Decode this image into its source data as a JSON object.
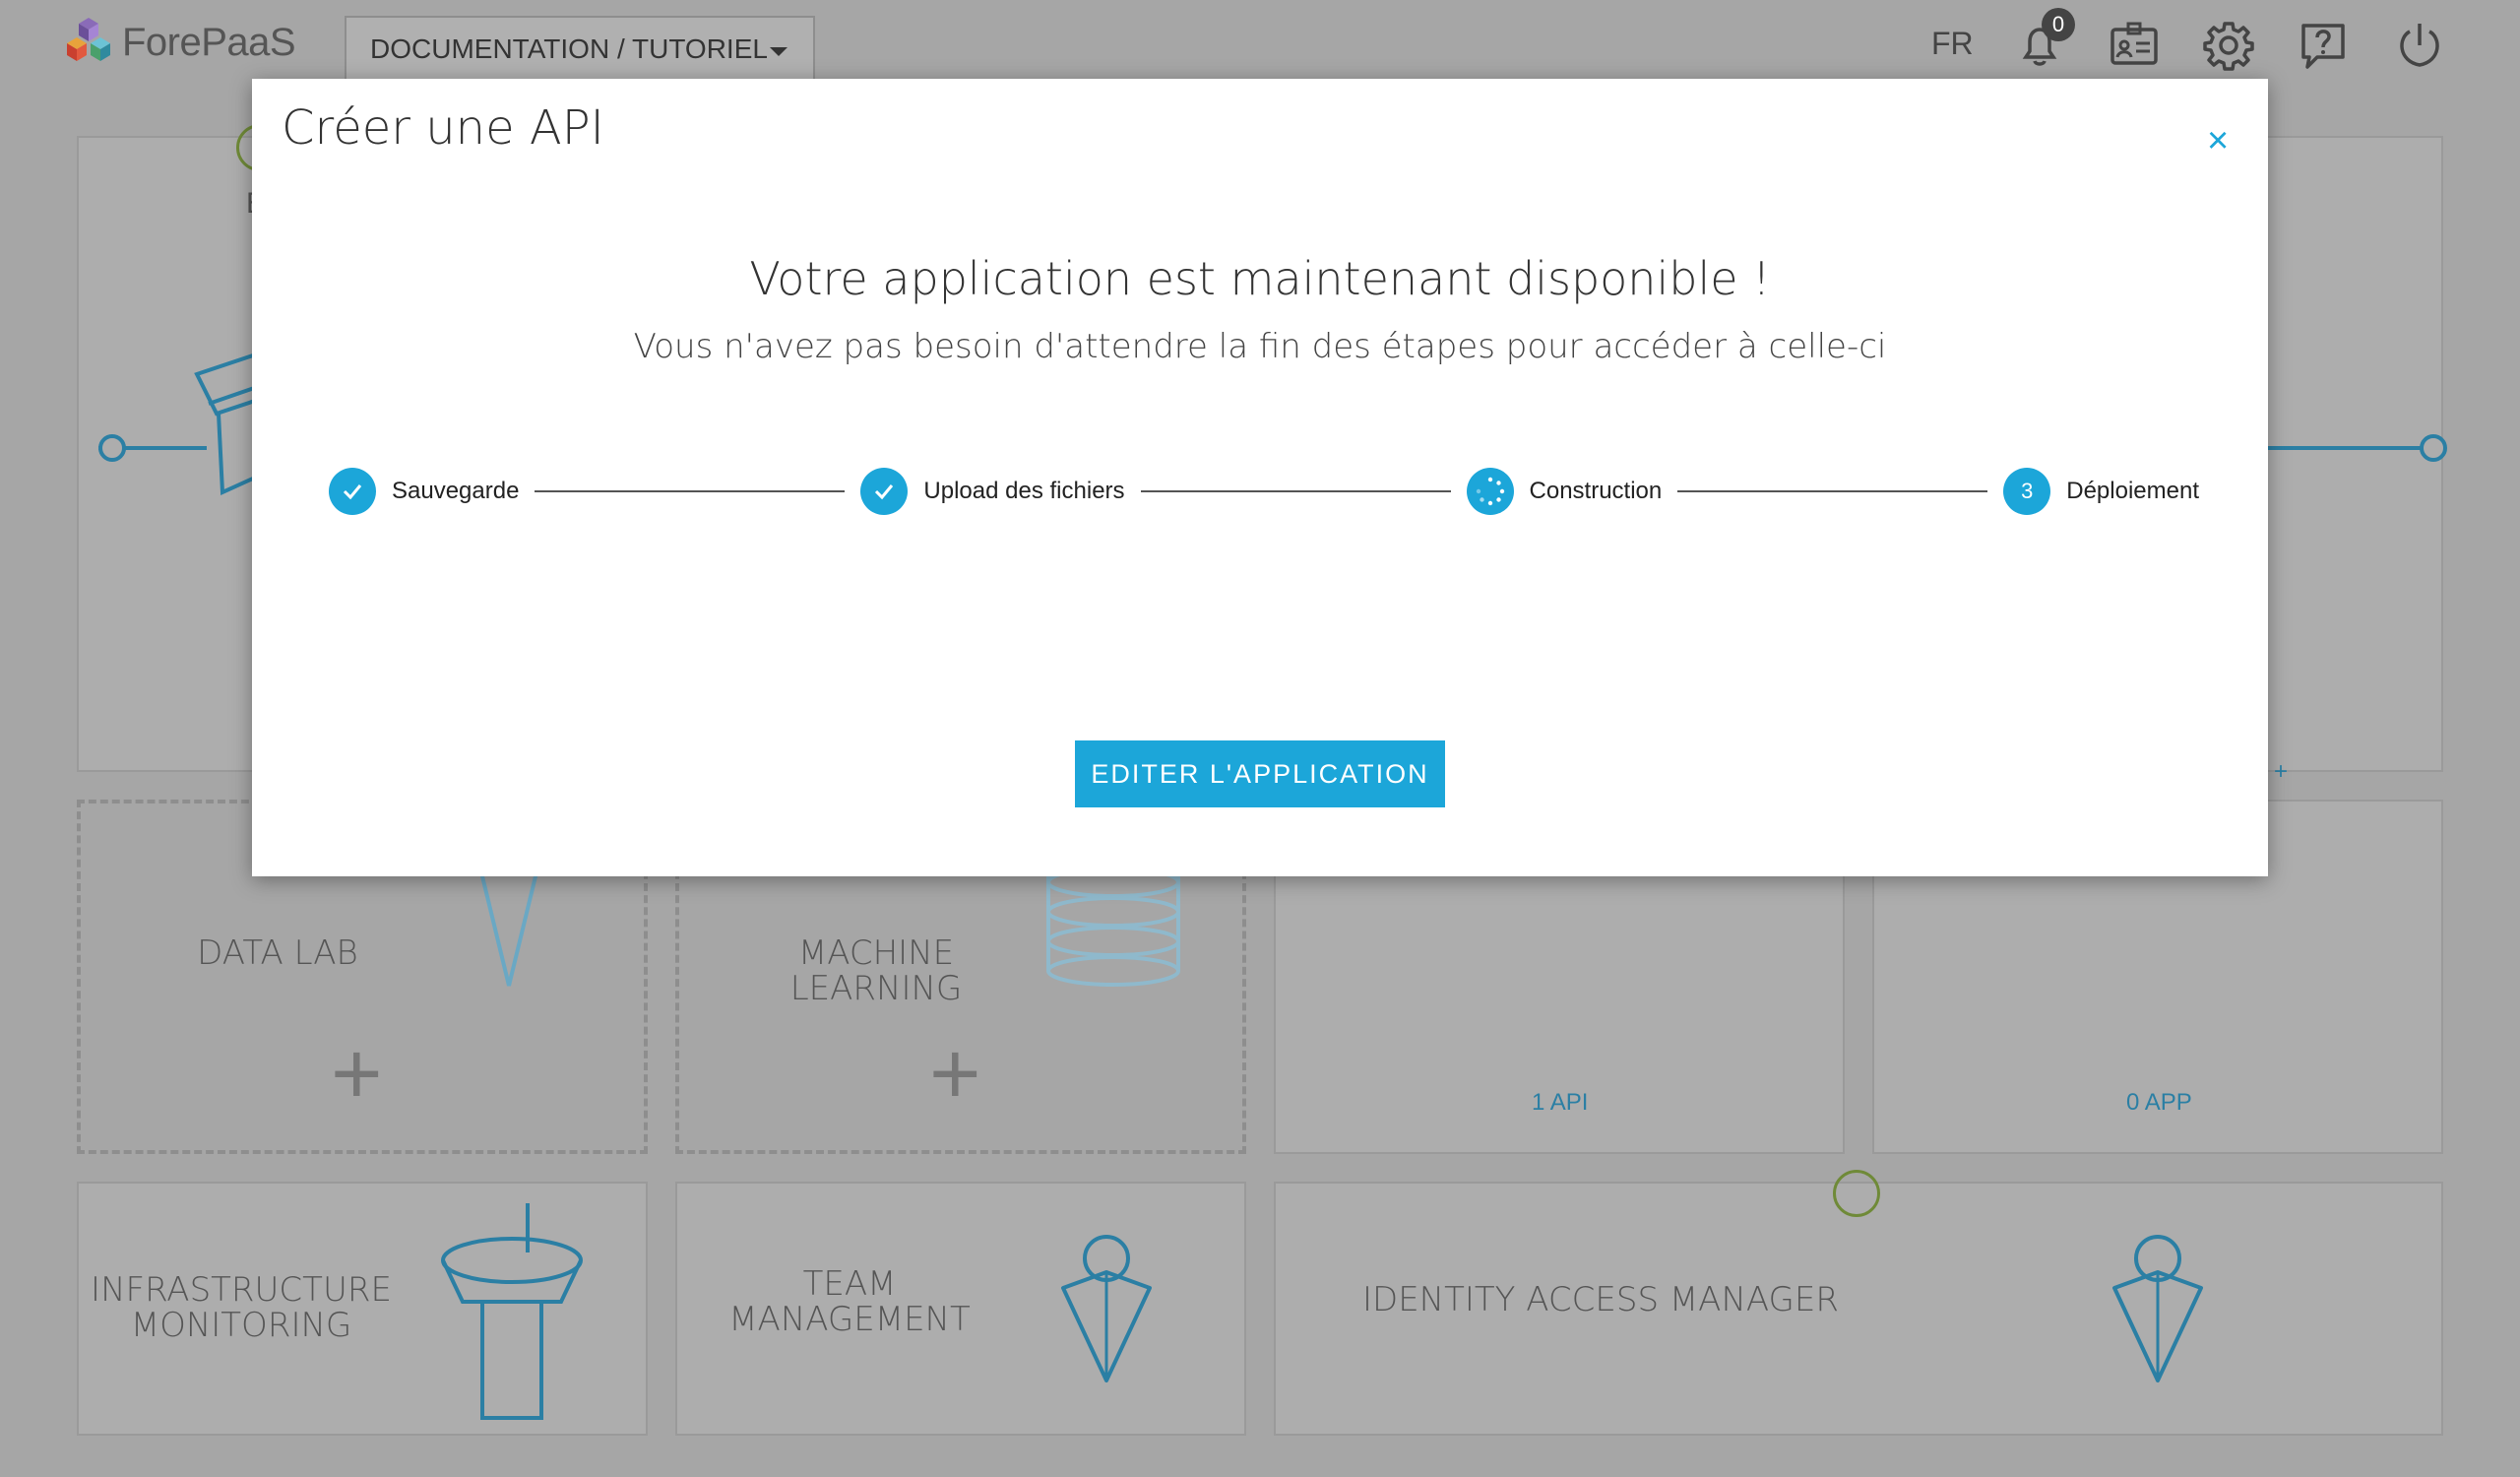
{
  "header": {
    "logo_text": "ForePaaS",
    "project_selector": "DOCUMENTATION / TUTORIEL",
    "language": "FR",
    "notification_count": "0",
    "icons": [
      "bell-icon",
      "id-card-icon",
      "gear-icon",
      "help-icon",
      "power-icon"
    ]
  },
  "tiles": {
    "data_lab": {
      "title": "DATA LAB",
      "plus": "+"
    },
    "machine_learning": {
      "title": "MACHINE LEARNING",
      "plus": "+"
    },
    "api": {
      "count": "1 API"
    },
    "app": {
      "count": "0 APP"
    },
    "infra": {
      "title": "INFRASTRUCTURE MONITORING"
    },
    "team": {
      "title": "TEAM MANAGEMENT"
    },
    "iam": {
      "title": "IDENTITY ACCESS MANAGER"
    },
    "partial_letter": "E",
    "small_plus": "+"
  },
  "modal": {
    "title": "Créer une API",
    "close": "×",
    "heading": "Votre application est maintenant disponible !",
    "subheading": "Vous n'avez pas besoin d'attendre la fin des étapes pour accéder à celle-ci",
    "steps": [
      {
        "label": "Sauvegarde",
        "state": "done"
      },
      {
        "label": "Upload des fichiers",
        "state": "done"
      },
      {
        "label": "Construction",
        "state": "loading"
      },
      {
        "label": "Déploiement",
        "state": "pending",
        "number": "3"
      }
    ],
    "button": "EDITER L'APPLICATION"
  },
  "colors": {
    "accent": "#1ca6d9",
    "overlay_bg": "#a6a6a6",
    "success": "#6f8a38",
    "link": "#2b7fa4"
  }
}
